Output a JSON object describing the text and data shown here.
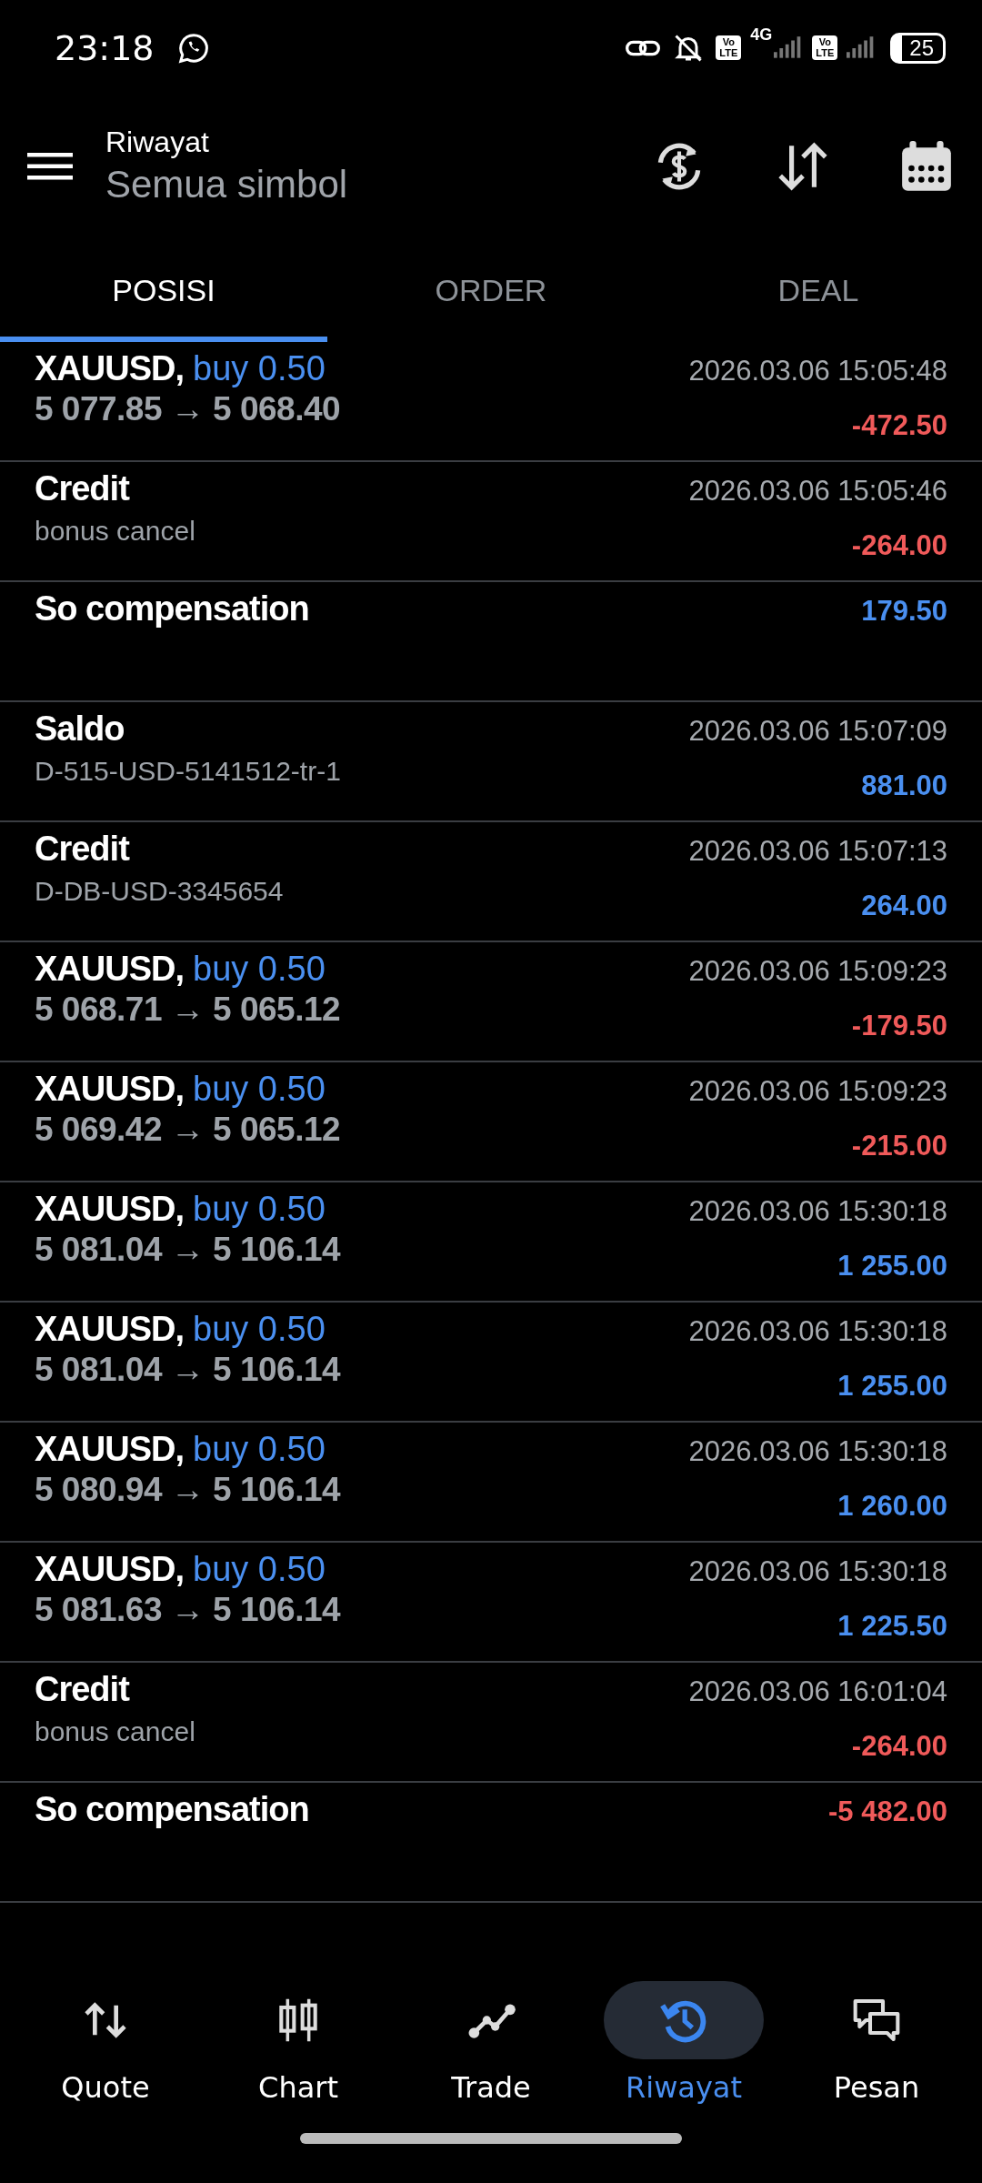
{
  "status_bar": {
    "time": "23:18",
    "network": "4G",
    "sim_badges": [
      {
        "top": "Vo",
        "bottom": "LTE"
      },
      {
        "top": "Vo",
        "bottom": "LTE"
      }
    ],
    "battery": "25"
  },
  "header": {
    "title": "Riwayat",
    "subtitle": "Semua simbol"
  },
  "tabs": [
    {
      "label": "POSISI",
      "selected": true
    },
    {
      "label": "ORDER",
      "selected": false
    },
    {
      "label": "DEAL",
      "selected": false
    }
  ],
  "rows": [
    {
      "kind": "trade",
      "symbol": "XAUUSD,",
      "side": "buy 0.50",
      "prices": "5 077.85 → 5 068.40",
      "time": "2026.03.06 15:05:48",
      "amount": "-472.50",
      "color": "#f05a5a"
    },
    {
      "kind": "balance",
      "title": "Credit",
      "comment": "bonus cancel",
      "time": "2026.03.06 15:05:46",
      "amount": "-264.00",
      "color": "#f05a5a"
    },
    {
      "kind": "balance",
      "title": "So compensation",
      "amount": "179.50",
      "color": "#4a8ff0"
    },
    {
      "kind": "balance",
      "title": "Saldo",
      "comment": "D-515-USD-5141512-tr-1",
      "time": "2026.03.06 15:07:09",
      "amount": "881.00",
      "color": "#4a8ff0"
    },
    {
      "kind": "balance",
      "title": "Credit",
      "comment": "D-DB-USD-3345654",
      "time": "2026.03.06 15:07:13",
      "amount": "264.00",
      "color": "#4a8ff0"
    },
    {
      "kind": "trade",
      "symbol": "XAUUSD,",
      "side": "buy 0.50",
      "prices": "5 068.71 → 5 065.12",
      "time": "2026.03.06 15:09:23",
      "amount": "-179.50",
      "color": "#f05a5a"
    },
    {
      "kind": "trade",
      "symbol": "XAUUSD,",
      "side": "buy 0.50",
      "prices": "5 069.42 → 5 065.12",
      "time": "2026.03.06 15:09:23",
      "amount": "-215.00",
      "color": "#f05a5a"
    },
    {
      "kind": "trade",
      "symbol": "XAUUSD,",
      "side": "buy 0.50",
      "prices": "5 081.04 → 5 106.14",
      "time": "2026.03.06 15:30:18",
      "amount": "1 255.00",
      "color": "#4a8ff0"
    },
    {
      "kind": "trade",
      "symbol": "XAUUSD,",
      "side": "buy 0.50",
      "prices": "5 081.04 → 5 106.14",
      "time": "2026.03.06 15:30:18",
      "amount": "1 255.00",
      "color": "#4a8ff0"
    },
    {
      "kind": "trade",
      "symbol": "XAUUSD,",
      "side": "buy 0.50",
      "prices": "5 080.94 → 5 106.14",
      "time": "2026.03.06 15:30:18",
      "amount": "1 260.00",
      "color": "#4a8ff0"
    },
    {
      "kind": "trade",
      "symbol": "XAUUSD,",
      "side": "buy 0.50",
      "prices": "5 081.63 → 5 106.14",
      "time": "2026.03.06 15:30:18",
      "amount": "1 225.50",
      "color": "#4a8ff0"
    },
    {
      "kind": "balance",
      "title": "Credit",
      "comment": "bonus cancel",
      "time": "2026.03.06 16:01:04",
      "amount": "-264.00",
      "color": "#f05a5a"
    },
    {
      "kind": "balance",
      "title": "So compensation",
      "amount": "-5 482.00",
      "color": "#f05a5a"
    }
  ],
  "bottom_nav": [
    {
      "kind": "quote",
      "label": "Quote",
      "selected": false
    },
    {
      "kind": "chart",
      "label": "Chart",
      "selected": false
    },
    {
      "kind": "trade",
      "label": "Trade",
      "selected": false
    },
    {
      "kind": "history",
      "label": "Riwayat",
      "selected": true
    },
    {
      "kind": "messages",
      "label": "Pesan",
      "selected": false
    }
  ]
}
